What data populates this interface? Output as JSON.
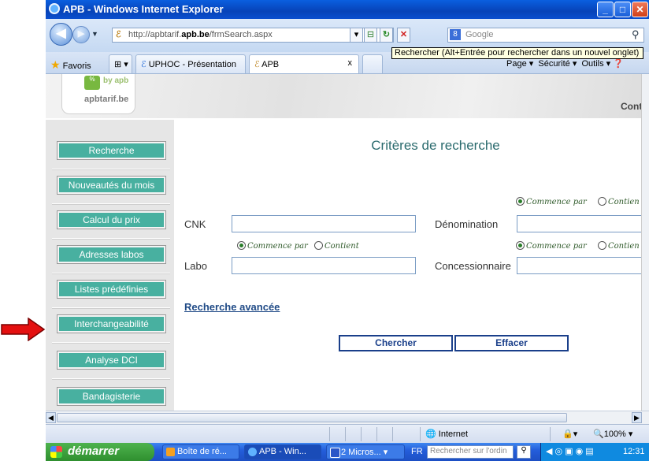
{
  "window": {
    "title": "APB - Windows Internet Explorer",
    "min": "_",
    "max": "□",
    "close": "✕"
  },
  "address": {
    "url_prefix": "http://apbtarif.",
    "url_domain": "apb.be",
    "url_path": "/frmSearch.aspx",
    "search_placeholder": "Google"
  },
  "tooltip": "Rechercher (Alt+Entrée pour rechercher dans un nouvel onglet)",
  "tabs": {
    "favorites": "Favoris",
    "items": [
      {
        "label": "UPHOC - Présentation"
      },
      {
        "label": "APB"
      }
    ],
    "close": "x"
  },
  "commandbar": {
    "page": "Page ▾",
    "securite": "Sécurité ▾",
    "outils": "Outils ▾"
  },
  "banner": {
    "logo_by": "by apb",
    "logo_name": "apbtarif.be",
    "logo_mark": "%",
    "right_text": "Cont"
  },
  "sidebar": {
    "items": [
      {
        "label": "Recherche"
      },
      {
        "label": "Nouveautés du mois"
      },
      {
        "label": "Calcul du prix"
      },
      {
        "label": "Adresses labos"
      },
      {
        "label": "Listes prédéfinies"
      },
      {
        "label": "Interchangeabilité"
      },
      {
        "label": "Analyse DCI"
      },
      {
        "label": "Bandagisterie"
      }
    ]
  },
  "search": {
    "title": "Critères de recherche",
    "fields": {
      "cnk": "CNK",
      "denomination": "Dénomination",
      "labo": "Labo",
      "concessionnaire": "Concessionnaire"
    },
    "radio": {
      "starts": "Commence par",
      "contains": "Contient",
      "contains_cut": "Contien"
    },
    "advanced": "Recherche avancée",
    "buttons": {
      "search": "Chercher",
      "clear": "Effacer"
    }
  },
  "status": {
    "zone": "Internet",
    "zoom": "100%"
  },
  "taskbar": {
    "start": "démarrer",
    "tasks": [
      {
        "label": "Boîte de ré..."
      },
      {
        "label": "APB - Win..."
      },
      {
        "label": "2 Micros..."
      }
    ],
    "lang": "FR",
    "desktop_search": "Rechercher sur l'ordin",
    "clock": "12:31"
  }
}
